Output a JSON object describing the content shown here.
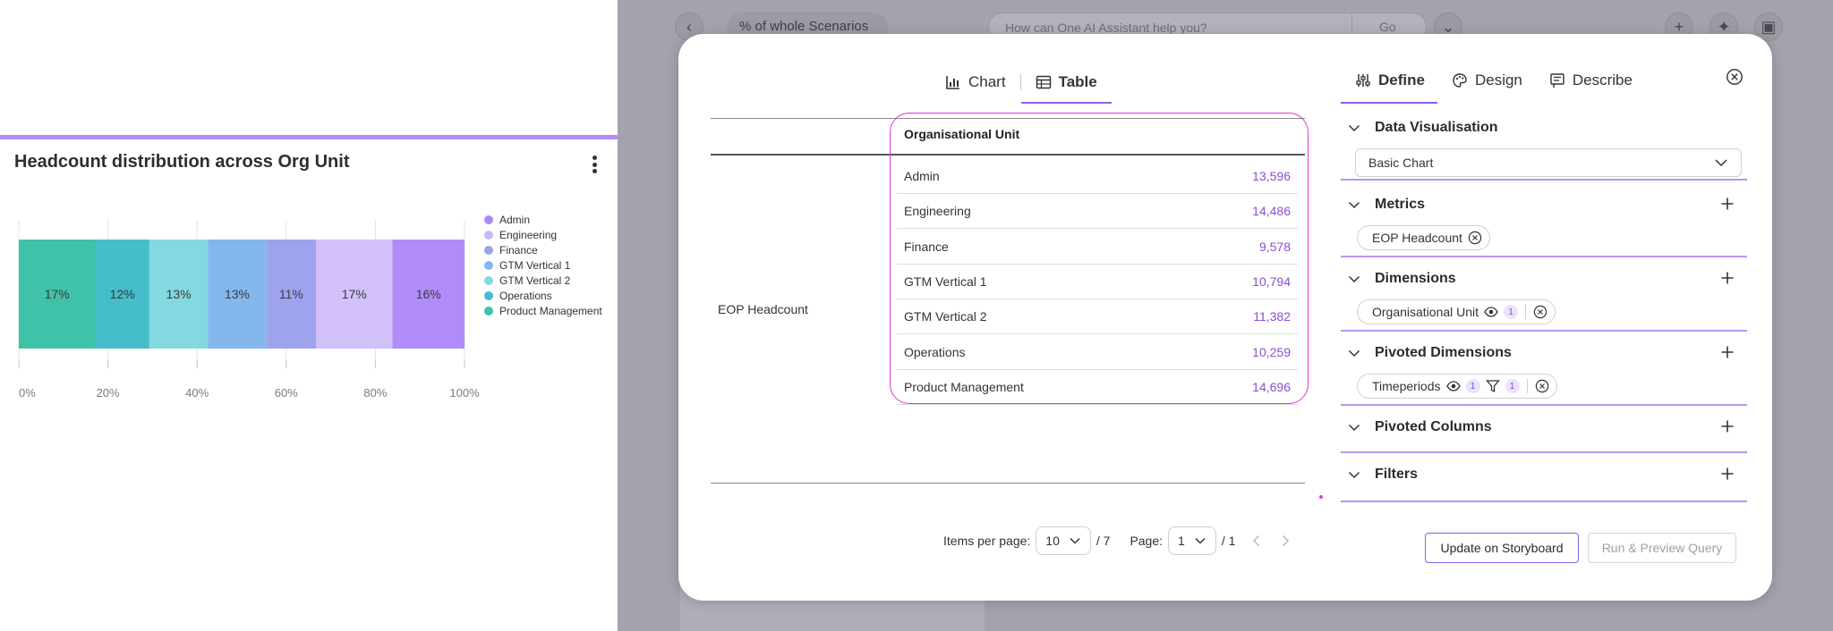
{
  "widget": {
    "title": "Headcount distribution across Org Unit"
  },
  "chart_data": {
    "type": "bar",
    "orientation": "horizontal-stacked-percent",
    "categories": [
      "EOP Headcount"
    ],
    "series": [
      {
        "name": "Admin",
        "values": [
          17
        ],
        "label": "17%",
        "color": "#3fc2a8"
      },
      {
        "name": "Engineering",
        "values": [
          12
        ],
        "label": "12%",
        "color": "#46bdca"
      },
      {
        "name": "Finance",
        "values": [
          13
        ],
        "label": "13%",
        "color": "#84d8e0"
      },
      {
        "name": "GTM Vertical 1",
        "values": [
          13
        ],
        "label": "13%",
        "color": "#84b7ec"
      },
      {
        "name": "GTM Vertical 2",
        "values": [
          11
        ],
        "label": "11%",
        "color": "#9ea3ee"
      },
      {
        "name": "Operations",
        "values": [
          17
        ],
        "label": "17%",
        "color": "#d1c0fa"
      },
      {
        "name": "Product Management",
        "values": [
          16
        ],
        "label": "16%",
        "color": "#b18cf8"
      }
    ],
    "legend": [
      {
        "name": "Admin",
        "color": "#a98bf5"
      },
      {
        "name": "Engineering",
        "color": "#cbb9f7"
      },
      {
        "name": "Finance",
        "color": "#9ea3ee"
      },
      {
        "name": "GTM Vertical 1",
        "color": "#84b7ec"
      },
      {
        "name": "GTM Vertical 2",
        "color": "#84d8e0"
      },
      {
        "name": "Operations",
        "color": "#46bdca"
      },
      {
        "name": "Product Management",
        "color": "#3fc2a8"
      }
    ],
    "xticks": [
      "0%",
      "20%",
      "40%",
      "60%",
      "80%",
      "100%"
    ],
    "xlim": [
      0,
      100
    ],
    "grid": true,
    "legend_position": "right"
  },
  "background": {
    "scenario": "% of whole Scenarios",
    "ask_placeholder": "How can One AI Assistant help you?",
    "go_label": "Go"
  },
  "modal": {
    "view_tabs": [
      {
        "label": "Chart",
        "icon": "bar-chart-icon"
      },
      {
        "label": "Table",
        "icon": "table-icon"
      }
    ],
    "table": {
      "header": "Organisational Unit",
      "row_dimension": "EOP Headcount",
      "rows": [
        {
          "label": "Admin",
          "value": "13,596"
        },
        {
          "label": "Engineering",
          "value": "14,486"
        },
        {
          "label": "Finance",
          "value": "9,578"
        },
        {
          "label": "GTM Vertical 1",
          "value": "10,794"
        },
        {
          "label": "GTM Vertical 2",
          "value": "11,382"
        },
        {
          "label": "Operations",
          "value": "10,259"
        },
        {
          "label": "Product Management",
          "value": "14,696"
        }
      ]
    },
    "pagination": {
      "items_label": "Items per page:",
      "items_value": "10",
      "items_total": "/ 7",
      "page_label": "Page:",
      "page_value": "1",
      "page_total": "/ 1"
    },
    "side_tabs": [
      {
        "label": "Define",
        "icon": "sliders-icon"
      },
      {
        "label": "Design",
        "icon": "palette-icon"
      },
      {
        "label": "Describe",
        "icon": "describe-icon"
      }
    ],
    "sections": {
      "data_visualisation": {
        "title": "Data Visualisation",
        "select_value": "Basic Chart"
      },
      "metrics": {
        "title": "Metrics",
        "chip": "EOP Headcount"
      },
      "dimensions": {
        "title": "Dimensions",
        "chip": "Organisational Unit",
        "count": "1"
      },
      "pivoted_dimensions": {
        "title": "Pivoted Dimensions",
        "chip": "Timeperiods",
        "count": "1",
        "filter_count": "1"
      },
      "pivoted_columns": {
        "title": "Pivoted Columns"
      },
      "filters": {
        "title": "Filters"
      }
    },
    "buttons": {
      "update": "Update on Storyboard",
      "run": "Run & Preview Query"
    },
    "colors": {
      "accent": "#8a60e6",
      "highlight": "#e038d8",
      "value_text": "#8a4fd0"
    }
  }
}
